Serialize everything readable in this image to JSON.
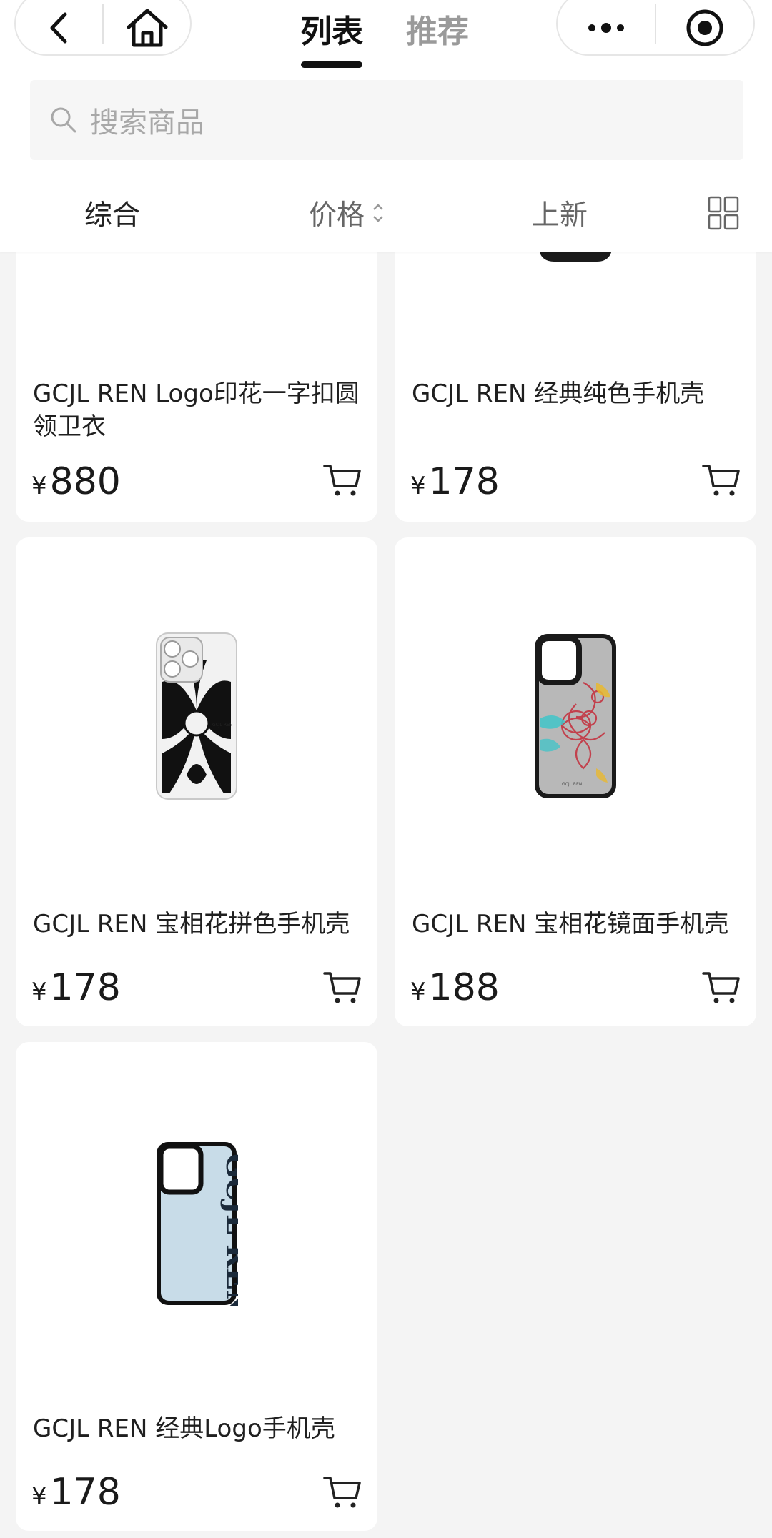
{
  "header": {
    "tabs": [
      {
        "label": "列表",
        "active": true
      },
      {
        "label": "推荐",
        "active": false
      }
    ],
    "icons": [
      "back-icon",
      "home-icon",
      "more-icon",
      "close-target-icon"
    ]
  },
  "search": {
    "placeholder": "搜索商品"
  },
  "sort": {
    "items": [
      "综合",
      "价格",
      "上新"
    ],
    "view_toggle_icon": "grid-view-icon"
  },
  "products": [
    {
      "title": "GCJL REN Logo印花一字扣圆领卫衣",
      "currency": "¥",
      "price": "880"
    },
    {
      "title": "GCJL REN 经典纯色手机壳",
      "currency": "¥",
      "price": "178"
    },
    {
      "title": "GCJL REN 宝相花拼色手机壳",
      "currency": "¥",
      "price": "178"
    },
    {
      "title": "GCJL REN 宝相花镜面手机壳",
      "currency": "¥",
      "price": "188"
    },
    {
      "title": "GCJL REN 经典Logo手机壳",
      "currency": "¥",
      "price": "178"
    }
  ],
  "case_print": {
    "logo_text": "GCJL REN"
  },
  "colors": {
    "background": "#f4f4f4",
    "card": "#ffffff",
    "text": "#1a1a1a",
    "muted": "#9a9a9a"
  }
}
